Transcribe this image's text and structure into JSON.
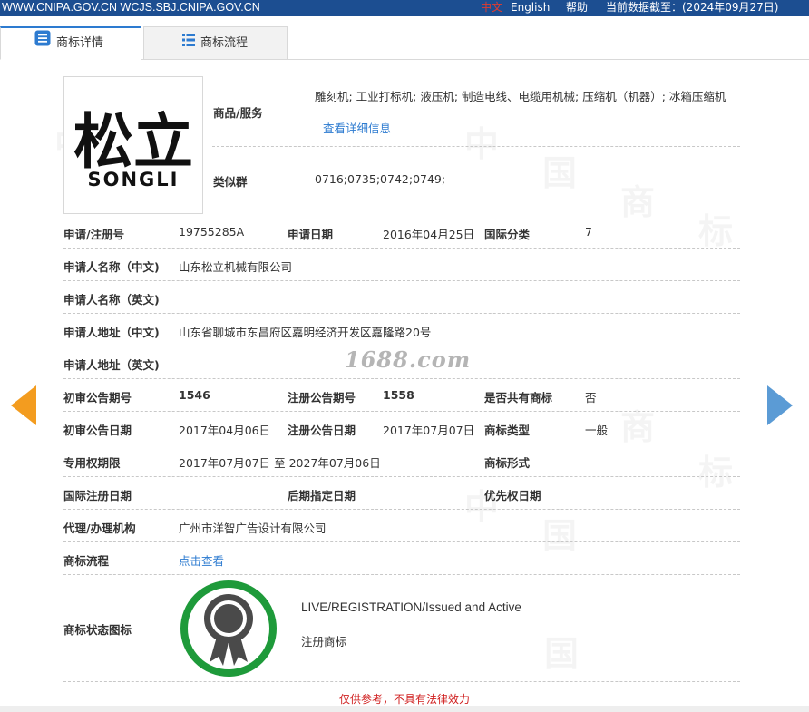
{
  "topbar": {
    "site": "WWW.CNIPA.GOV.CN WCJS.SBJ.CNIPA.GOV.CN",
    "lang_cn": "中文",
    "lang_en": "English",
    "help": "帮助",
    "data_date": "当前数据截至：(2024年09月27日)"
  },
  "tabs": [
    {
      "label": "商标详情",
      "icon": "list-detail-icon",
      "active": true
    },
    {
      "label": "商标流程",
      "icon": "list-flow-icon",
      "active": false
    }
  ],
  "logo": {
    "chinese": "松立",
    "latin": "SONGLI"
  },
  "goods": {
    "label": "商品/服务",
    "value": "雕刻机; 工业打标机; 液压机; 制造电线、电缆用机械; 压缩机（机器）; 冰箱压缩机",
    "detail_link": "查看详细信息"
  },
  "similar": {
    "label": "类似群",
    "value": "0716;0735;0742;0749;"
  },
  "fields": {
    "reg_no_label": "申请/注册号",
    "reg_no": "19755285A",
    "apply_date_label": "申请日期",
    "apply_date": "2016年04月25日",
    "intl_class_label": "国际分类",
    "intl_class": "7",
    "applicant_cn_label": "申请人名称（中文)",
    "applicant_cn": "山东松立机械有限公司",
    "applicant_en_label": "申请人名称（英文)",
    "applicant_en": "",
    "address_cn_label": "申请人地址（中文)",
    "address_cn": "山东省聊城市东昌府区嘉明经济开发区嘉隆路20号",
    "address_en_label": "申请人地址（英文)",
    "address_en": "",
    "prelim_no_label": "初审公告期号",
    "prelim_no": "1546",
    "reg_notice_no_label": "注册公告期号",
    "reg_notice_no": "1558",
    "shared_label": "是否共有商标",
    "shared": "否",
    "prelim_date_label": "初审公告日期",
    "prelim_date": "2017年04月06日",
    "reg_notice_date_label": "注册公告日期",
    "reg_notice_date": "2017年07月07日",
    "mark_type_label": "商标类型",
    "mark_type": "一般",
    "exclusive_label": "专用权期限",
    "exclusive": "2017年07月07日 至 2027年07月06日",
    "mark_form_label": "商标形式",
    "mark_form": "",
    "intl_reg_date_label": "国际注册日期",
    "later_designation_label": "后期指定日期",
    "priority_date_label": "优先权日期",
    "agent_label": "代理/办理机构",
    "agent": "广州市洋智广告设计有限公司",
    "process_label": "商标流程",
    "process_link": "点击查看",
    "status_label": "商标状态图标"
  },
  "status": {
    "en": "LIVE/REGISTRATION/Issued and Active",
    "cn": "注册商标",
    "ring_color": "#1e9a3a"
  },
  "watermark_text": "1688.com",
  "footer_note": "仅供参考，不具有法律效力",
  "colors": {
    "topbar": "#1c4e91",
    "arrow_left": "#f39c1f",
    "arrow_right": "#5b9bd5",
    "link": "#2d7bd0",
    "note": "#d02020"
  }
}
